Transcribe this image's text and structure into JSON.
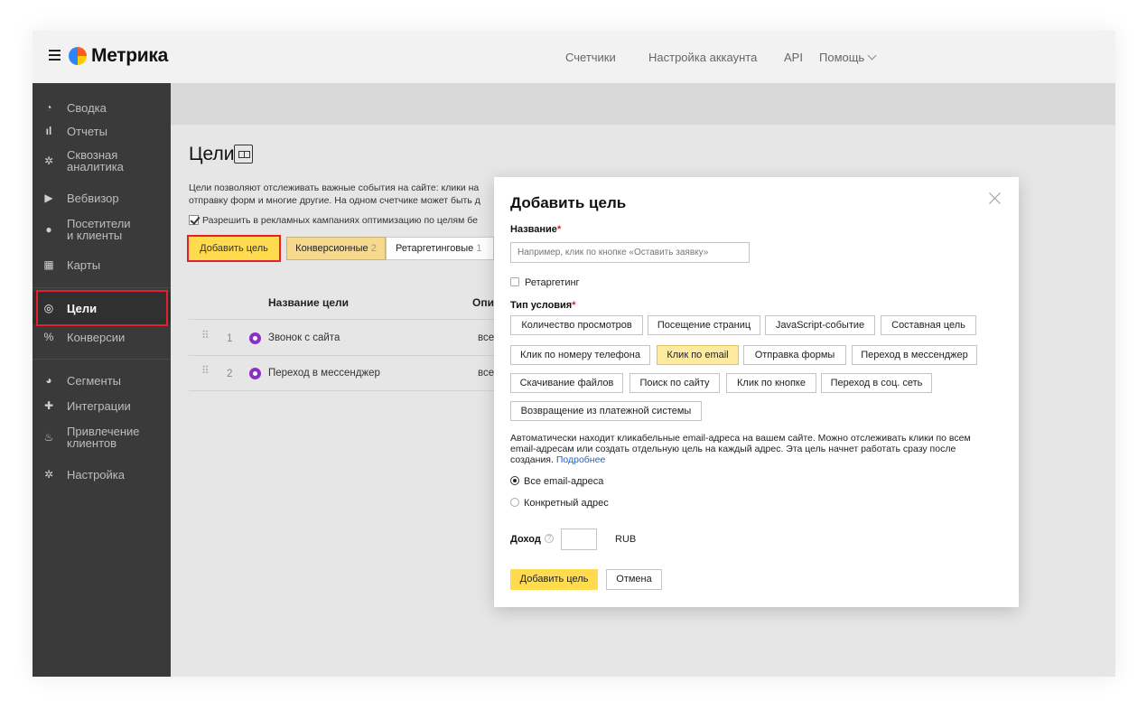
{
  "header": {
    "logo_text": "Метрика",
    "nav": [
      "Счетчики",
      "Настройка аккаунта",
      "API",
      "Помощь"
    ]
  },
  "sidebar": {
    "items": [
      {
        "label": "Сводка",
        "icon": "dashboard-icon"
      },
      {
        "label": "Отчеты",
        "icon": "bar-chart-icon"
      },
      {
        "label": "Сквозная аналитика",
        "icon": "asterisk-icon"
      },
      {
        "label": "Вебвизор",
        "icon": "play-icon"
      },
      {
        "label": "Посетители и клиенты",
        "icon": "person-icon"
      },
      {
        "label": "Карты",
        "icon": "map-icon"
      },
      {
        "label": "Цели",
        "icon": "target-icon",
        "active": true
      },
      {
        "label": "Конверсии",
        "icon": "percent-icon"
      },
      {
        "label": "Сегменты",
        "icon": "pie-icon"
      },
      {
        "label": "Интеграции",
        "icon": "puzzle-icon"
      },
      {
        "label": "Привлечение клиентов",
        "icon": "flame-icon"
      },
      {
        "label": "Настройка",
        "icon": "gear-icon"
      }
    ]
  },
  "page": {
    "title": "Цели",
    "description_line1": "Цели позволяют отслеживать важные события на сайте: клики на",
    "description_line2": "отправку форм и многие другие. На одном счетчике может быть д",
    "optimize_checkbox": "Разрешить в рекламных кампаниях оптимизацию по целям бе",
    "add_button": "Добавить цель",
    "tabs": [
      {
        "label": "Конверсионные",
        "count": "2"
      },
      {
        "label": "Ретаргетинговые",
        "count": "1"
      }
    ],
    "table": {
      "col_name": "Название цели",
      "col_desc": "Опи",
      "rows": [
        {
          "num": "1",
          "name": "Звонок с сайта",
          "value": "все"
        },
        {
          "num": "2",
          "name": "Переход в мессенджер",
          "value": "все"
        }
      ]
    }
  },
  "modal": {
    "title": "Добавить цель",
    "name_label": "Название",
    "name_placeholder": "Например, клик по кнопке «Оставить заявку»",
    "retargeting_label": "Ретаргетинг",
    "condition_label": "Тип условия",
    "conditions": [
      "Количество просмотров",
      "Посещение страниц",
      "JavaScript-событие",
      "Составная цель",
      "Клик по номеру телефона",
      "Клик по email",
      "Отправка формы",
      "Переход в мессенджер",
      "Скачивание файлов",
      "Поиск по сайту",
      "Клик по кнопке",
      "Переход в соц. сеть",
      "Возвращение из платежной системы"
    ],
    "selected_condition": "Клик по email",
    "help_line1": "Автоматически находит кликабельные email-адреса на вашем сайте. Можно отслеживать клики по всем",
    "help_line2": "email-адресам или создать отдельную цель на каждый адрес. Эта цель начнет работать сразу после",
    "help_line3": "создания.",
    "help_link": "Подробнее",
    "radio_all": "Все email-адреса",
    "radio_specific": "Конкретный адрес",
    "radio_selected": "Все email-адреса",
    "income_label": "Доход",
    "income_value": "",
    "currency": "RUB",
    "submit_label": "Добавить цель",
    "cancel_label": "Отмена"
  },
  "colors": {
    "accent_yellow": "#ffdb4d",
    "sidebar_bg": "#3a3a3a",
    "highlight_red": "#e3202c",
    "link_blue": "#1a63d1"
  }
}
